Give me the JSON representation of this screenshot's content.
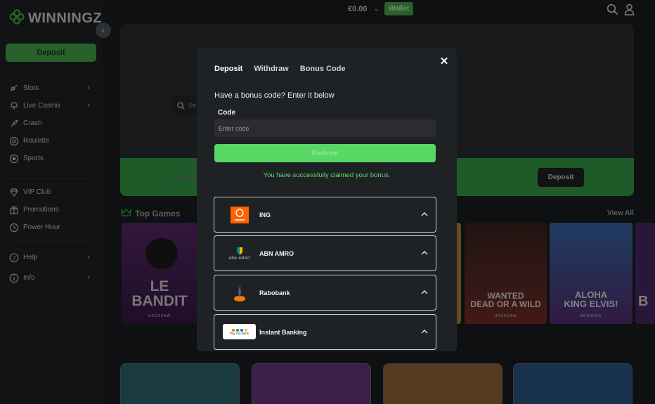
{
  "app": {
    "logo_text": "WINNINGZ"
  },
  "topbar": {
    "balance": "€0.00",
    "wallet_label": "Wallet"
  },
  "sidebar": {
    "deposit_label": "Deposit",
    "group1": [
      {
        "label": "Slots",
        "icon": "slots-icon",
        "chevron": true
      },
      {
        "label": "Live Casino",
        "icon": "live-casino-icon",
        "chevron": true
      },
      {
        "label": "Crash",
        "icon": "rocket-icon",
        "chevron": false
      },
      {
        "label": "Roulette",
        "icon": "roulette-icon",
        "chevron": false
      },
      {
        "label": "Sports",
        "icon": "football-icon",
        "chevron": false
      }
    ],
    "group2": [
      {
        "label": "VIP Club",
        "icon": "diamond-icon",
        "chevron": false
      },
      {
        "label": "Promotions",
        "icon": "gift-icon",
        "chevron": false
      },
      {
        "label": "Power Hour",
        "icon": "clock-icon",
        "chevron": false
      }
    ],
    "group3": [
      {
        "label": "Help",
        "icon": "help-icon",
        "chevron": true
      },
      {
        "label": "Info",
        "icon": "info-icon",
        "chevron": true
      }
    ]
  },
  "background": {
    "hero_text": "Win w",
    "hero_search_placeholder": "Se",
    "hero_deposit": "Deposit",
    "top_games": "Top Games",
    "view_all": "View All",
    "tiles": [
      {
        "title": "LE BANDIT",
        "provider": "HACKSAW"
      },
      {
        "title": "WANTED\nDEAD OR A WILD",
        "provider": "HACKSAW"
      },
      {
        "title": "ALOHA\nKING ELVIS!",
        "provider": "BGAMING"
      },
      {
        "title": "B",
        "provider": ""
      }
    ]
  },
  "modal": {
    "tabs": [
      "Deposit",
      "Withdraw",
      "Bonus Code"
    ],
    "heading": "Have a bonus code? Enter it below",
    "code_label": "Code",
    "code_placeholder": "Enter code",
    "redeem_label": "Redeem",
    "success_message": "You have successfully claimed your bonus.",
    "banks": [
      {
        "name": "ING"
      },
      {
        "name": "ABN AMRO",
        "logo_text": "ABN·AMRO"
      },
      {
        "name": "Rabobank"
      },
      {
        "name": "Instant Banking",
        "logo_text": "Pay Via Bank"
      }
    ]
  },
  "colors": {
    "accent": "#4caf50",
    "success": "#5fdc67",
    "modal_bg": "#1f2225"
  }
}
